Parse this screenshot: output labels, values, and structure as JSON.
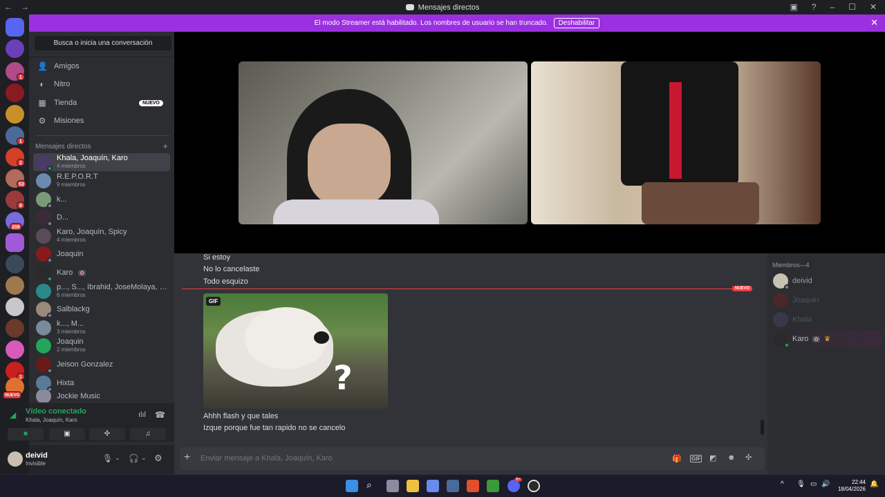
{
  "window": {
    "title": "Mensajes directos"
  },
  "banner": {
    "text": "El modo Streamer está habilitado. Los nombres de usuario se han truncado.",
    "button": "Deshabilitar"
  },
  "guild_badges": [
    "1",
    "2",
    "53",
    "8",
    "208",
    "1",
    "1",
    "NUEVO"
  ],
  "sidebar": {
    "search": "Busca o inicia una conversación",
    "nav": [
      {
        "label": "Amigos",
        "icon": "friends-icon"
      },
      {
        "label": "Nitro",
        "icon": "nitro-icon"
      },
      {
        "label": "Tienda",
        "icon": "shop-icon",
        "badge": "NUEVO"
      },
      {
        "label": "Misiones",
        "icon": "quests-icon"
      }
    ],
    "dm_header": "Mensajes directos",
    "dms": [
      {
        "name": "Khala, Joaquín, Karo",
        "sub": "4 miembros"
      },
      {
        "name": "R.E.P.O.R.T",
        "sub": "9 miembros"
      },
      {
        "name": "k...",
        "sub": ""
      },
      {
        "name": "D...",
        "sub": ""
      },
      {
        "name": "Karo, Joaquín, Spicy",
        "sub": "4 miembros"
      },
      {
        "name": "Joaquin",
        "sub": ""
      },
      {
        "name": "Karo",
        "sub": ""
      },
      {
        "name": "p..., S..., Ibrahid, JoseMolaya, Jud...",
        "sub": "6 miembros"
      },
      {
        "name": "Salblackg",
        "sub": ""
      },
      {
        "name": "k..., M...",
        "sub": "3 miembros"
      },
      {
        "name": "Joaquin",
        "sub": "2 miembros"
      },
      {
        "name": "Jeison Gonzalez",
        "sub": ""
      },
      {
        "name": "Hixta",
        "sub": ""
      },
      {
        "name": "Jockie Music",
        "sub": ""
      }
    ]
  },
  "voice": {
    "status": "Vídeo conectado",
    "channel": "Khala, Joaquín, Karo"
  },
  "user": {
    "name": "deivid",
    "status": "Invisible"
  },
  "messages": {
    "before": [
      "Si estoy",
      "No lo cancelaste",
      "Todo esquizo"
    ],
    "new_label": "NUEVO",
    "gif_label": "GIF",
    "after": [
      "Ahhh flash y que tales",
      "Izque porque fue tan rapido no se cancelo"
    ]
  },
  "input": {
    "placeholder": "Enviar mensaje a Khala, Joaquín, Karo"
  },
  "members": {
    "header": "Miembros—4",
    "list": [
      "deivid",
      "Joaquin",
      "Khala",
      "Karo"
    ]
  },
  "taskbar": {
    "time": "22:44",
    "date": "18/04/2026",
    "discord_badge": "9+"
  }
}
